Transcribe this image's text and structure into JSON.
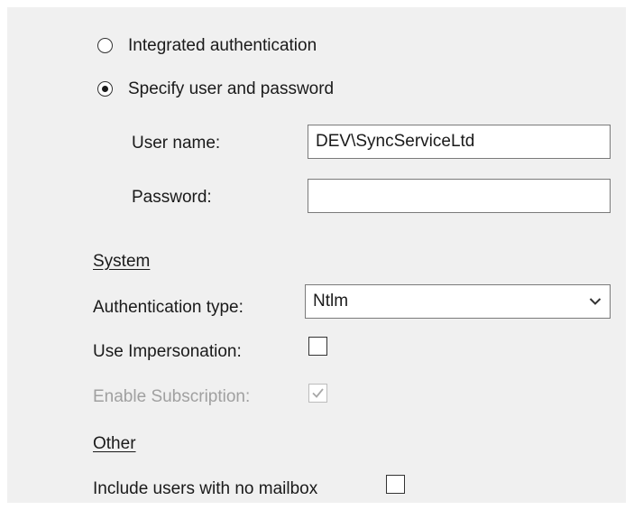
{
  "auth_mode": {
    "integrated_label": "Integrated authentication",
    "integrated_selected": false,
    "specify_label": "Specify user and password",
    "specify_selected": true
  },
  "credentials": {
    "username_label": "User name:",
    "username_value": "DEV\\SyncServiceLtd",
    "password_label": "Password:",
    "password_value": ""
  },
  "system": {
    "section_label": "System",
    "auth_type_label": "Authentication type:",
    "auth_type_value": "Ntlm",
    "impersonation_label": "Use Impersonation:",
    "impersonation_checked": false,
    "subscription_label": "Enable Subscription:",
    "subscription_checked": true,
    "subscription_enabled": false
  },
  "other": {
    "section_label": "Other",
    "no_mailbox_label": "Include users with no mailbox",
    "no_mailbox_checked": false
  },
  "icons": {
    "dropdown": "chevron-down-icon",
    "check": "checkmark-icon"
  },
  "colors": {
    "panel_bg": "#f0f0f0",
    "text": "#1a1a1a",
    "disabled_text": "#a0a0a0",
    "border": "#7a7a7a"
  }
}
